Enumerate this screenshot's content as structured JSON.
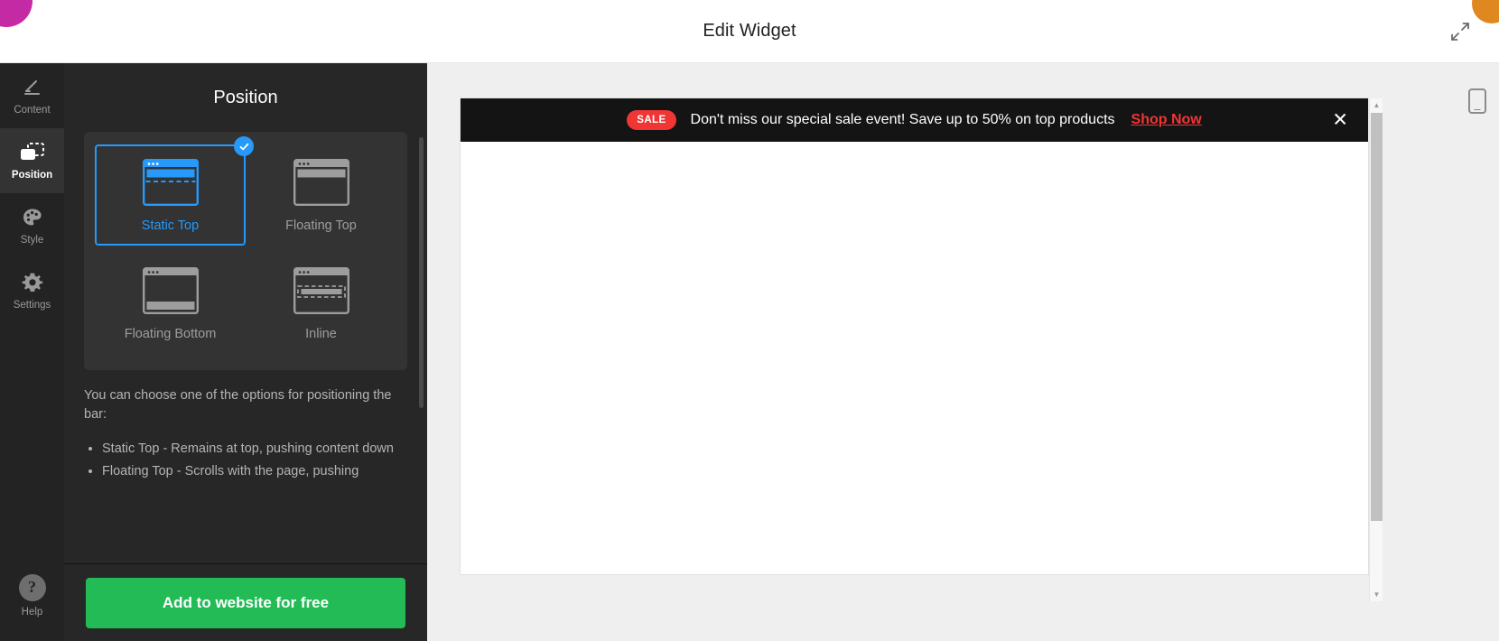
{
  "header": {
    "title": "Edit Widget",
    "expand_icon": "expand-arrows-icon",
    "logo_icon": "brand-logo-blob",
    "corner_icon": "orange-corner-blob"
  },
  "rail": {
    "items": [
      {
        "id": "content",
        "label": "Content",
        "icon": "pencil-icon",
        "active": false
      },
      {
        "id": "position",
        "label": "Position",
        "icon": "position-frame-icon",
        "active": true
      },
      {
        "id": "style",
        "label": "Style",
        "icon": "palette-icon",
        "active": false
      },
      {
        "id": "settings",
        "label": "Settings",
        "icon": "gear-icon",
        "active": false
      }
    ],
    "help": {
      "label": "Help",
      "icon": "question-mark-icon",
      "glyph": "?"
    }
  },
  "panel": {
    "title": "Position",
    "options": [
      {
        "id": "static-top",
        "label": "Static Top",
        "selected": true
      },
      {
        "id": "floating-top",
        "label": "Floating Top",
        "selected": false
      },
      {
        "id": "floating-bottom",
        "label": "Floating Bottom",
        "selected": false
      },
      {
        "id": "inline",
        "label": "Inline",
        "selected": false
      }
    ],
    "check_icon": "check-mark-icon",
    "description_intro": "You can choose one of the options for positioning the bar:",
    "description_bullets": [
      "Static Top - Remains at top, pushing content down",
      "Floating Top - Scrolls with the page, pushing"
    ],
    "cta_label": "Add to website for free"
  },
  "preview": {
    "banner": {
      "badge": "SALE",
      "message": "Don't miss our special sale event! Save up to 50% on top products",
      "link_label": "Shop Now",
      "close_icon": "close-x-icon",
      "background": "#141414",
      "badge_color": "#f03535",
      "link_color": "#f03535"
    },
    "mobile_toggle_icon": "mobile-device-icon",
    "scrollbar": {
      "up_icon": "caret-up-icon",
      "down_icon": "caret-down-icon"
    }
  },
  "colors": {
    "accent_blue": "#2699fb",
    "cta_green": "#22bb55",
    "panel_bg": "#272727",
    "rail_bg": "#232323"
  }
}
